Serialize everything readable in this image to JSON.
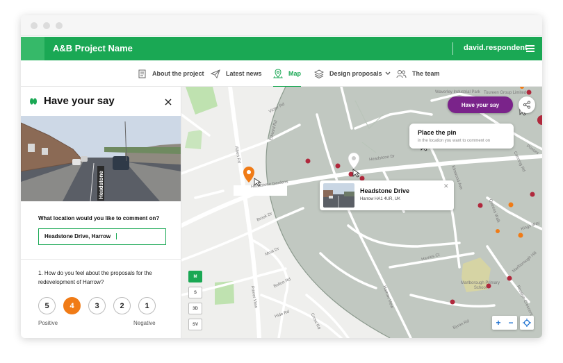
{
  "app": {
    "project_name": "A&B Project Name",
    "user": "david.respondent"
  },
  "nav": {
    "items": [
      {
        "label": "About the project",
        "icon": "document-icon"
      },
      {
        "label": "Latest news",
        "icon": "paper-plane-icon"
      },
      {
        "label": "Map",
        "icon": "map-pin-icon",
        "active": true
      },
      {
        "label": "Design proposals",
        "icon": "layers-icon"
      },
      {
        "label": "The team",
        "icon": "people-icon"
      }
    ]
  },
  "panel": {
    "title": "Have your say",
    "location_question": "What location would you like to comment on?",
    "location_value": "Headstone Drive, Harrow",
    "question": "1. How do you feel about the proposals for the redevelopment of Harrow?",
    "ratings": [
      "5",
      "4",
      "3",
      "2",
      "1"
    ],
    "selected_rating": "4",
    "positive_label": "Positive",
    "negative_label": "Negative",
    "street_sign": "Headstone"
  },
  "map": {
    "have_your_say_button": "Have your say",
    "tooltip": {
      "title": "Place the pin",
      "subtitle": "in the location you want to comment on"
    },
    "card": {
      "title": "Headstone Drive",
      "subtitle": "Harrow HA1 4UR, UK"
    },
    "view_modes": [
      "M",
      "S",
      "3D",
      "SV"
    ],
    "selected_view_mode": "M",
    "labels": {
      "victor_rd": "Victor Rd",
      "edward_rd": "Edward Rd",
      "albert_rd": "Albert Rd",
      "headstone_gardens": "Headstone Gardens",
      "headstone_dr": "Headstone Dr",
      "brook_dr": "Brook Dr",
      "moat_dr": "Moat Dr",
      "bolton_rd": "Bolton Rd",
      "hide_rd": "Hide Rd",
      "primer_view": "Primer View",
      "cross_rd": "Cross Rd",
      "harrow_view": "Harrow View",
      "harries_ct": "Harries Ct",
      "waverley_ind_park": "Waverley Industrial Park",
      "toureen_group": "Toureen Group Limited",
      "princes": "Princes",
      "kings_way": "Kings Way",
      "queens_walk": "Queens Walk",
      "elmwood_ave": "Elmwood Ave",
      "canning_rd": "Canning Rd",
      "marlborough_school": "Marlborough Primary School",
      "marlborough_hill": "Marlborough Hill",
      "rosslyn_cres": "Rosslyn Crescent",
      "byron_rd": "Byron Rd"
    }
  },
  "colors": {
    "brand_green": "#1aa854",
    "accent_purple": "#7a238a",
    "accent_orange": "#f07b16",
    "pin_red": "#b0283c"
  }
}
